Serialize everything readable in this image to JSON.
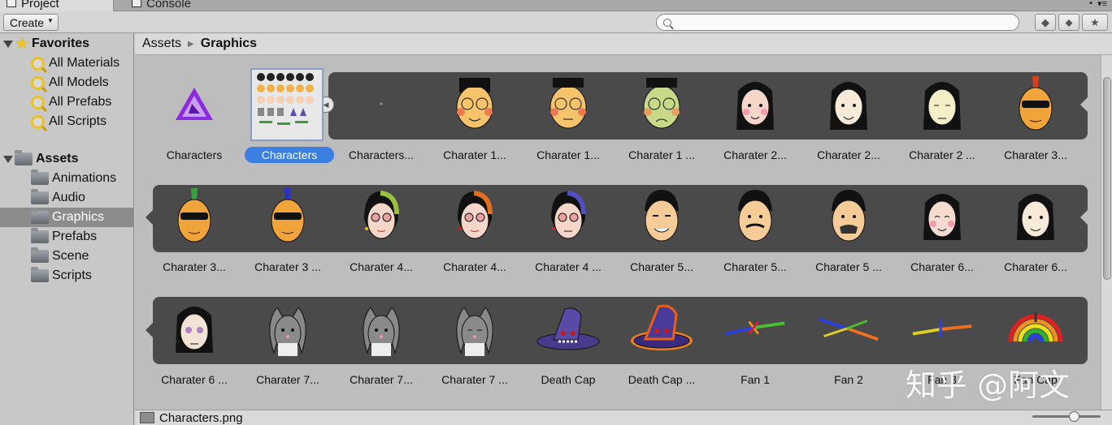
{
  "tabs": [
    {
      "label": "Project",
      "icon": "project-icon"
    },
    {
      "label": "Console",
      "icon": "console-icon"
    }
  ],
  "toolbar": {
    "create_label": "Create",
    "search": {
      "placeholder": "",
      "value": ""
    }
  },
  "sidebar": {
    "favorites": {
      "label": "Favorites",
      "items": [
        "All Materials",
        "All Models",
        "All Prefabs",
        "All Scripts"
      ]
    },
    "assets": {
      "label": "Assets",
      "items": [
        "Animations",
        "Audio",
        "Graphics",
        "Prefabs",
        "Scene",
        "Scripts"
      ],
      "selected": "Graphics"
    }
  },
  "breadcrumb": {
    "root": "Assets",
    "current": "Graphics"
  },
  "assets_rows": [
    [
      "Characters",
      "Characters",
      "Characters...",
      "Charater 1...",
      "Charater 1...",
      "Charater 1 ...",
      "Charater 2...",
      "Charater 2...",
      "Charater 2 ...",
      "Charater 3..."
    ],
    [
      "Charater 3...",
      "Charater 3 ...",
      "Charater 4...",
      "Charater 4...",
      "Charater 4 ...",
      "Charater 5...",
      "Charater 5...",
      "Charater 5 ...",
      "Charater 6...",
      "Charater 6..."
    ],
    [
      "Charater 6 ...",
      "Charater 7...",
      "Charater 7...",
      "Charater 7 ...",
      "Death Cap",
      "Death Cap ...",
      "Fan 1",
      "Fan 2",
      "Fan 3",
      "Fan Cap"
    ]
  ],
  "selected_asset": "Characters",
  "status": {
    "filename": "Characters.png"
  },
  "watermark": "知乎 @阿文",
  "colors": {
    "selection": "#3b7fe0",
    "strip": "#4a4a4a"
  }
}
